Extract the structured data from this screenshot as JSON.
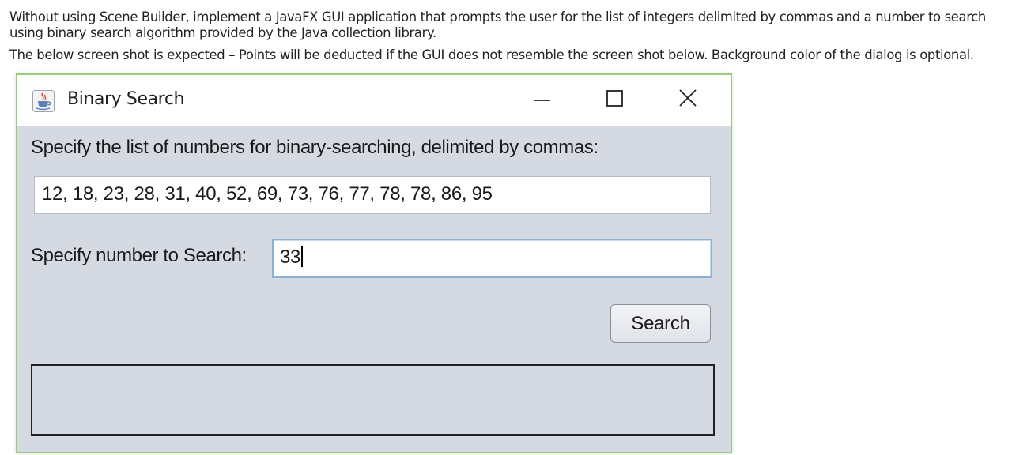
{
  "instructions": {
    "paragraph1": "Without using Scene Builder, implement a JavaFX GUI application that prompts the user for the list of integers delimited by commas and a number to search using binary search algorithm provided by the Java collection library.",
    "paragraph2": "The below screen shot is expected – Points will be deducted if the GUI does not resemble the screen shot below. Background color of the dialog is optional."
  },
  "window": {
    "title": "Binary Search",
    "icon": "java-coffee-cup-icon",
    "controls": [
      "minimize-icon",
      "maximize-icon",
      "close-icon"
    ]
  },
  "form": {
    "list_label": "Specify the list of numbers for binary-searching, delimited by commas:",
    "list_value": "12, 18, 23, 28, 31, 40, 52, 69, 73, 76, 77, 78, 78, 86, 95",
    "search_label": "Specify number to Search:",
    "search_value": "33",
    "search_button_label": "Search",
    "result_text": ""
  },
  "colors": {
    "window_background": "#d4d9e2",
    "window_border": "#9acb7a",
    "focus_border": "#8db1d3"
  }
}
